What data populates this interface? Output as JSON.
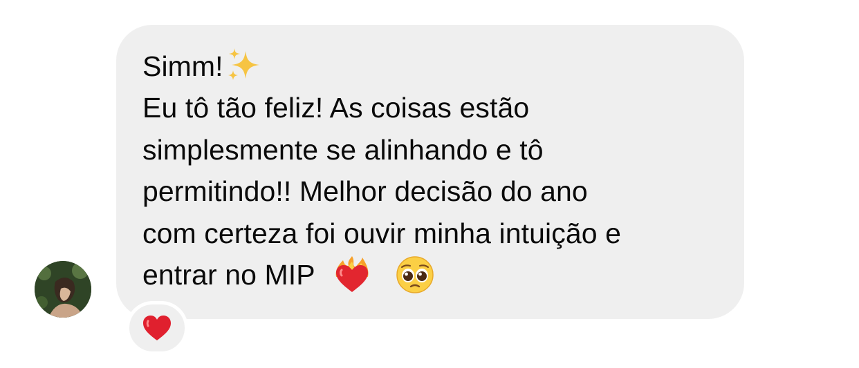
{
  "message": {
    "lines": [
      "Simm!",
      "Eu tô tão feliz! As coisas estão",
      "simplesmente se alinhando e tô",
      "permitindo!! Melhor decisão do ano",
      "com certeza foi ouvir minha intuição e",
      "entrar no MIP"
    ],
    "emojis": [
      "sparkles-icon",
      "heart-on-fire-icon",
      "pleading-face-icon"
    ]
  },
  "reaction": {
    "emoji": "red-heart-icon"
  },
  "colors": {
    "bubble": "#efefef",
    "text": "#0a0a0a",
    "background": "#ffffff",
    "reaction_heart": "#e0202e"
  }
}
